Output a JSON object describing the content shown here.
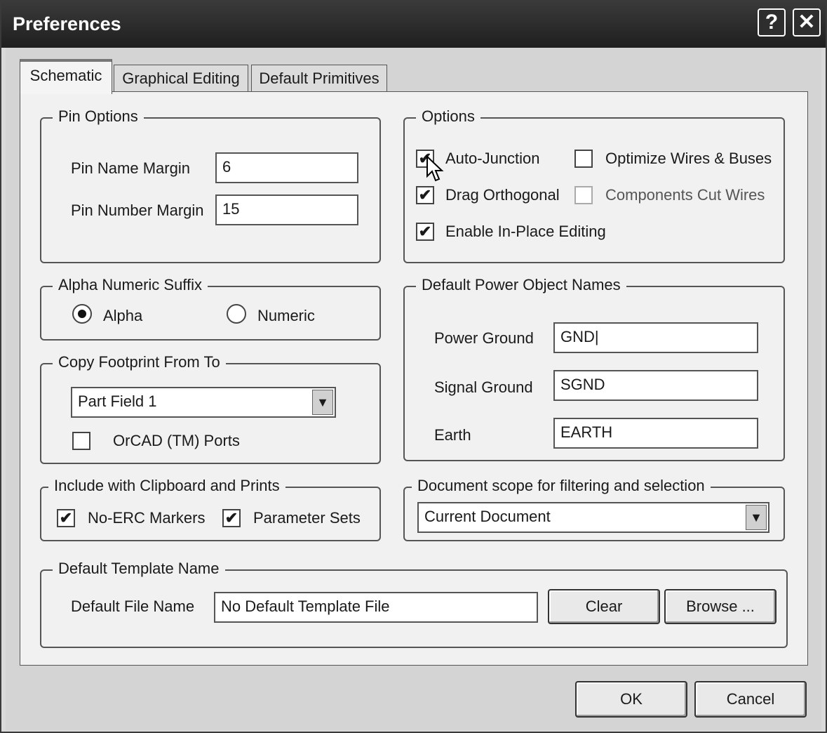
{
  "window": {
    "title": "Preferences",
    "help_label": "?",
    "close_label": "✕"
  },
  "tabs": [
    {
      "label": "Schematic"
    },
    {
      "label": "Graphical Editing"
    },
    {
      "label": "Default Primitives"
    }
  ],
  "pin_options": {
    "legend": "Pin Options",
    "name_margin_label": "Pin Name Margin",
    "name_margin_value": "6",
    "number_margin_label": "Pin Number Margin",
    "number_margin_value": "15"
  },
  "options": {
    "legend": "Options",
    "auto_junction": "Auto-Junction",
    "optimize_wires": "Optimize Wires & Buses",
    "drag_orthogonal": "Drag Orthogonal",
    "components_cut_wires": "Components Cut Wires",
    "enable_inplace": "Enable In-Place Editing",
    "check_glyph": "✔"
  },
  "alpha_suffix": {
    "legend": "Alpha Numeric Suffix",
    "alpha": "Alpha",
    "numeric": "Numeric"
  },
  "power_names": {
    "legend": "Default Power Object Names",
    "power_ground_label": "Power Ground",
    "power_ground_value": "GND|",
    "signal_ground_label": "Signal Ground",
    "signal_ground_value": "SGND",
    "earth_label": "Earth",
    "earth_value": "EARTH"
  },
  "copy_footprint": {
    "legend": "Copy Footprint From To",
    "selected": "Part Field 1",
    "orcad_ports": "OrCAD (TM) Ports"
  },
  "clipboard": {
    "legend": "Include with Clipboard and Prints",
    "no_erc": "No-ERC Markers",
    "param_sets": "Parameter Sets"
  },
  "doc_scope": {
    "legend": "Document scope for filtering and selection",
    "selected": "Current Document"
  },
  "template": {
    "legend": "Default Template Name",
    "file_label": "Default File Name",
    "file_value": "No Default Template File",
    "clear": "Clear",
    "browse": "Browse ..."
  },
  "footer": {
    "ok": "OK",
    "cancel": "Cancel"
  }
}
